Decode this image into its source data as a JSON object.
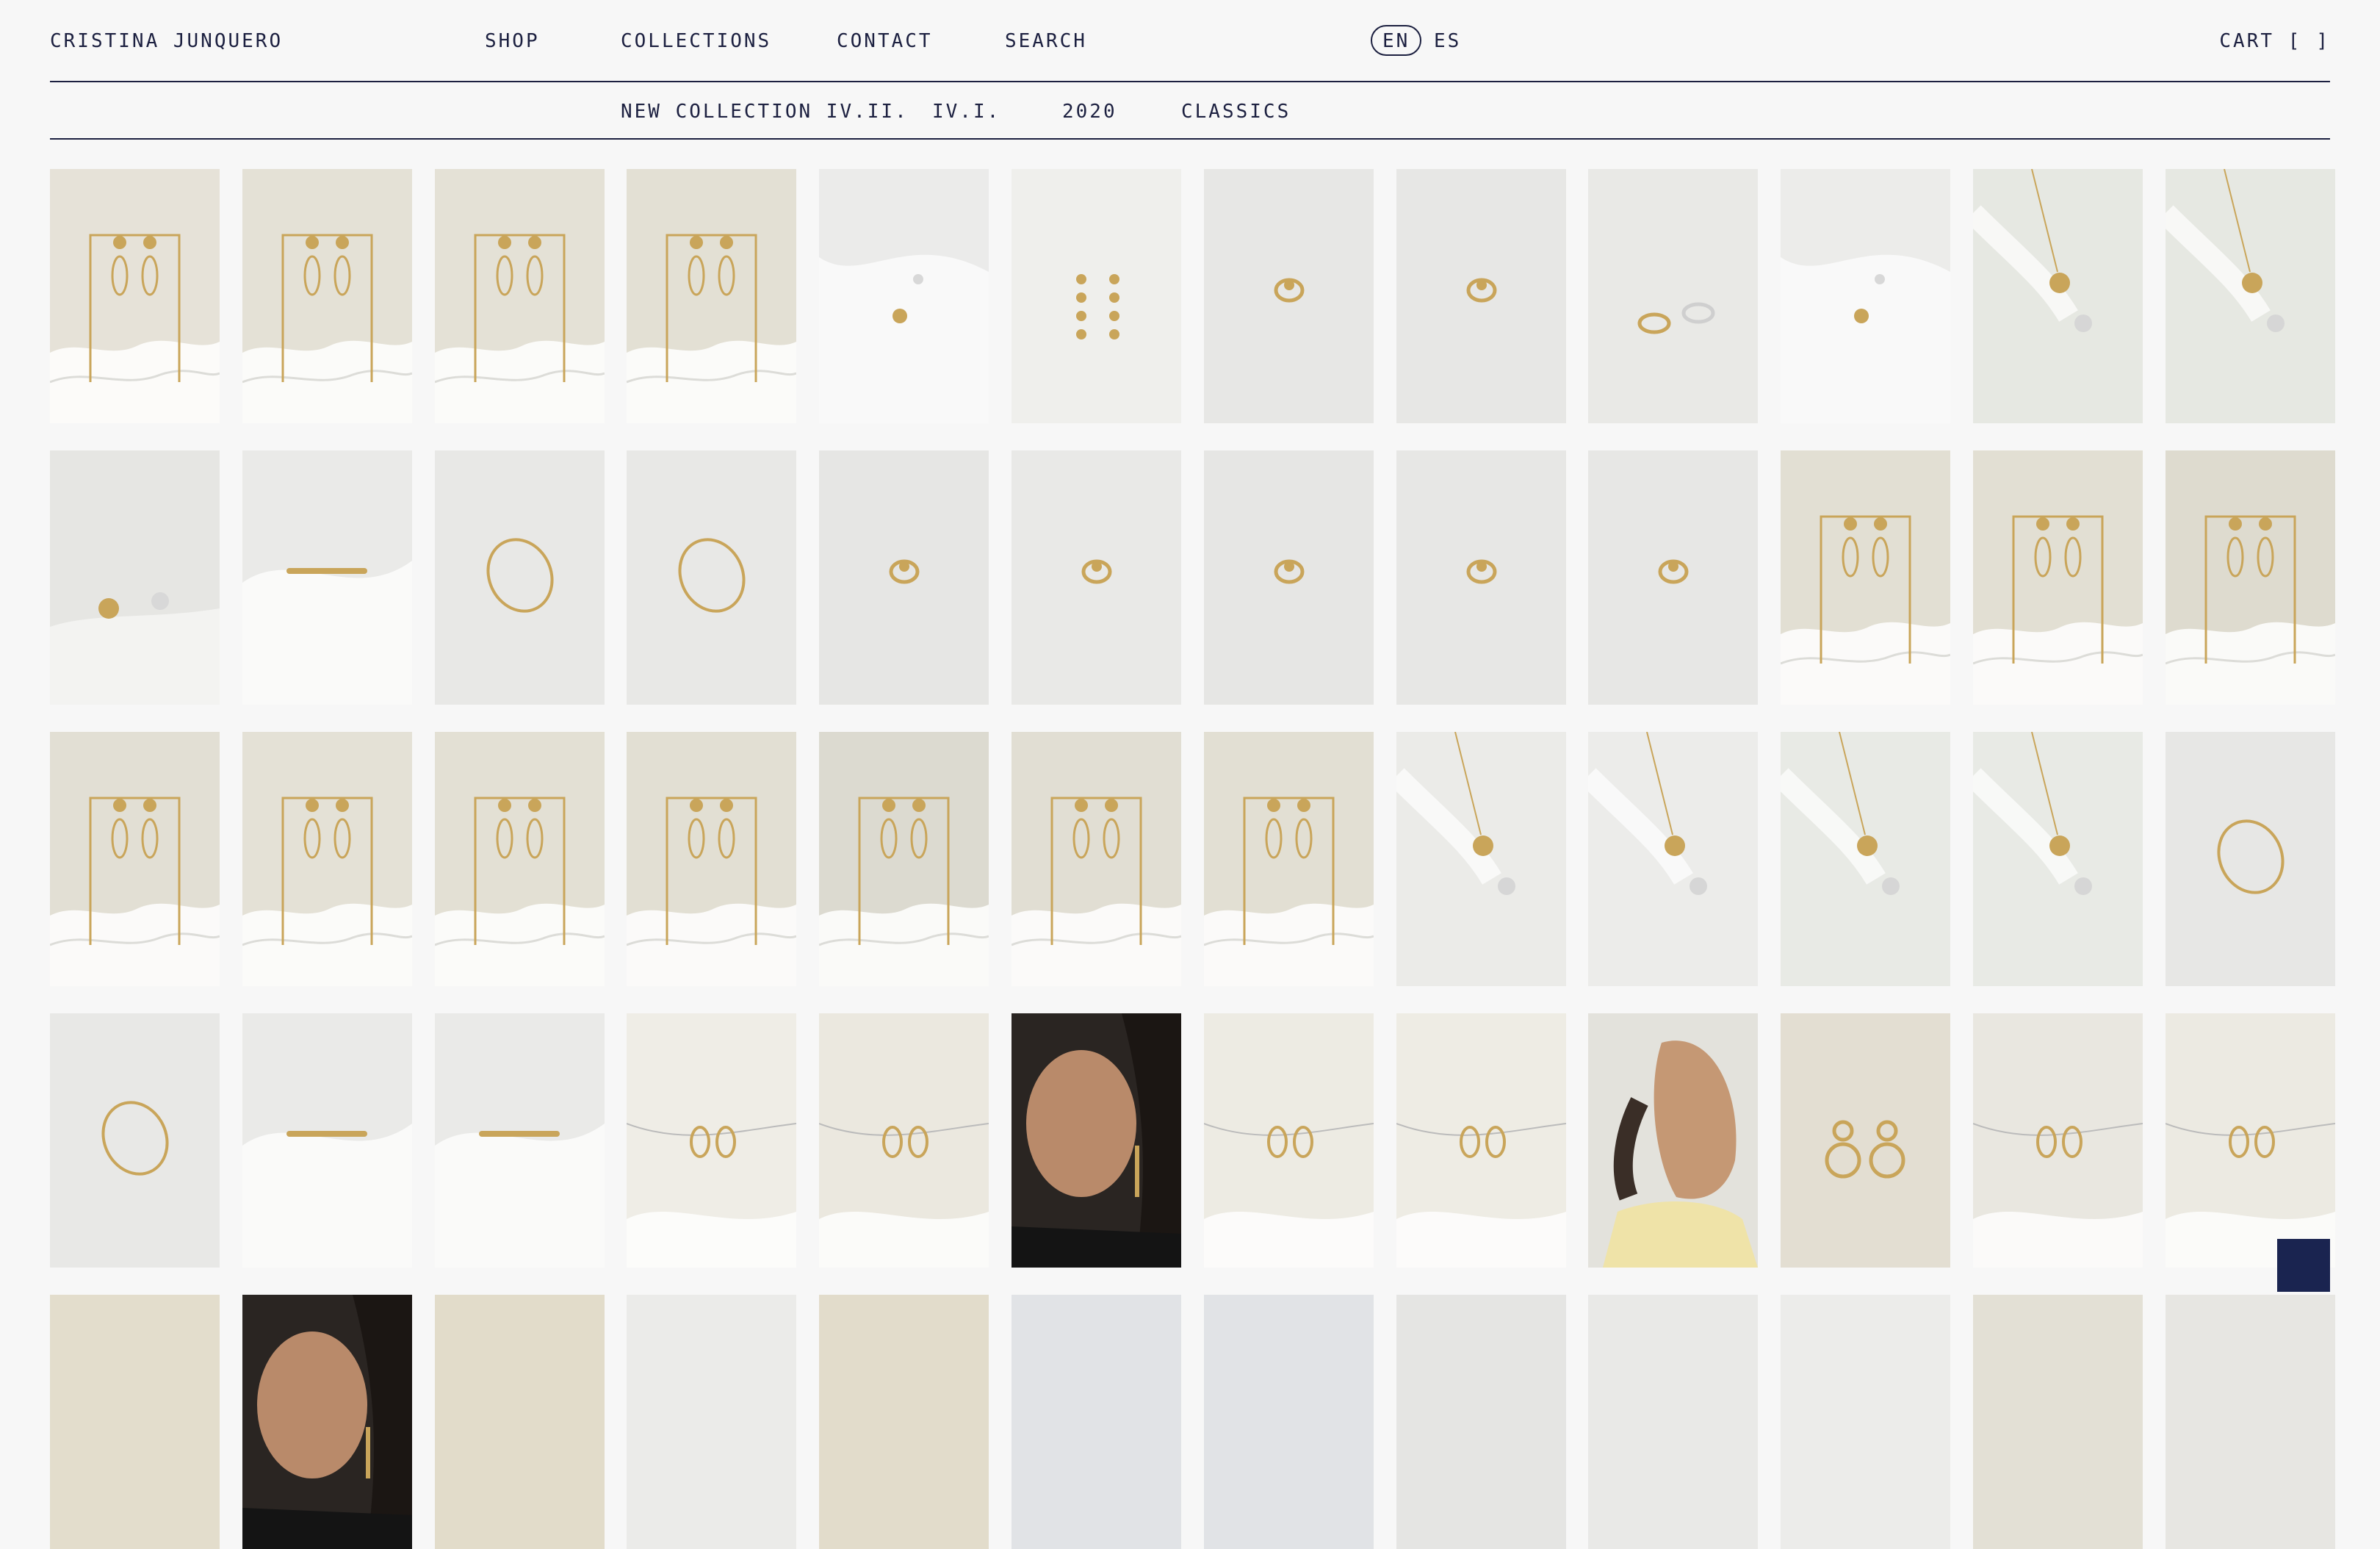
{
  "header": {
    "brand": "CRISTINA JUNQUERO",
    "nav": [
      "SHOP",
      "COLLECTIONS",
      "CONTACT",
      "SEARCH"
    ],
    "languages": [
      "EN",
      "ES"
    ],
    "active_language": "EN",
    "cart_label": "CART",
    "cart_open": "[",
    "cart_close": "]"
  },
  "subnav": [
    "NEW COLLECTION IV.II.",
    "IV.I.",
    "2020",
    "CLASSICS"
  ],
  "colors": {
    "text": "#1c2040",
    "accent": "#1a2450",
    "gold": "#c9a55a",
    "background": "#f7f7f7"
  },
  "products": [
    {
      "bg": "#e6e2d8",
      "type": "earring-stand"
    },
    {
      "bg": "#e4e1d6",
      "type": "earring-stand"
    },
    {
      "bg": "#e4e1d6",
      "type": "earring-stand"
    },
    {
      "bg": "#e3e0d4",
      "type": "earring-stand"
    },
    {
      "bg": "#ebebea",
      "type": "fabric-small"
    },
    {
      "bg": "#efefec",
      "type": "drop-chain"
    },
    {
      "bg": "#e7e7e5",
      "type": "ring"
    },
    {
      "bg": "#e7e7e5",
      "type": "ring"
    },
    {
      "bg": "#e9e9e6",
      "type": "two-rings"
    },
    {
      "bg": "#ececea",
      "type": "fabric-small"
    },
    {
      "bg": "#e6e8e2",
      "type": "necklace"
    },
    {
      "bg": "#e6e8e2",
      "type": "necklace"
    },
    {
      "bg": "#e6e6e3",
      "type": "two-small"
    },
    {
      "bg": "#eaeae8",
      "type": "fabric-bar"
    },
    {
      "bg": "#e8e8e6",
      "type": "bangle"
    },
    {
      "bg": "#e8e8e6",
      "type": "bangle"
    },
    {
      "bg": "#e6e6e4",
      "type": "ring"
    },
    {
      "bg": "#e9e9e7",
      "type": "ring"
    },
    {
      "bg": "#e6e6e4",
      "type": "ring"
    },
    {
      "bg": "#e7e7e5",
      "type": "ring"
    },
    {
      "bg": "#e7e7e5",
      "type": "ring"
    },
    {
      "bg": "#e2dfd3",
      "type": "earring-stand"
    },
    {
      "bg": "#e2dfd3",
      "type": "earring-stand"
    },
    {
      "bg": "#dedbcf",
      "type": "earring-stand"
    },
    {
      "bg": "#e2dfd4",
      "type": "earring-stand"
    },
    {
      "bg": "#e4e1d6",
      "type": "earring-stand"
    },
    {
      "bg": "#e3e0d4",
      "type": "earring-stand"
    },
    {
      "bg": "#e2dfd3",
      "type": "earring-stand"
    },
    {
      "bg": "#dcdad0",
      "type": "earring-stand"
    },
    {
      "bg": "#e1ded3",
      "type": "earring-stand"
    },
    {
      "bg": "#e2dfd3",
      "type": "earring-stand"
    },
    {
      "bg": "#ebebe8",
      "type": "necklace"
    },
    {
      "bg": "#ececea",
      "type": "necklace"
    },
    {
      "bg": "#e8eae5",
      "type": "necklace"
    },
    {
      "bg": "#e8eae5",
      "type": "necklace"
    },
    {
      "bg": "#e7e7e5",
      "type": "bangle"
    },
    {
      "bg": "#e8e8e6",
      "type": "bangle"
    },
    {
      "bg": "#eaeae8",
      "type": "fabric-bar"
    },
    {
      "bg": "#eaeae8",
      "type": "fabric-bar"
    },
    {
      "bg": "#efede6",
      "type": "wire-earrings"
    },
    {
      "bg": "#ebe8df",
      "type": "wire-earrings"
    },
    {
      "bg": "#d8cfc4",
      "type": "portrait-woman"
    },
    {
      "bg": "#edebe3",
      "type": "wire-earrings"
    },
    {
      "bg": "#eeece4",
      "type": "wire-earrings"
    },
    {
      "bg": "#e3e2dc",
      "type": "portrait-man"
    },
    {
      "bg": "#e3ded2",
      "type": "hoops"
    },
    {
      "bg": "#e9e7e0",
      "type": "wire-earrings"
    },
    {
      "bg": "#eceae2",
      "type": "wire-earrings"
    },
    {
      "bg": "#e3ddcc",
      "type": "plain"
    },
    {
      "bg": "#d9cfc4",
      "type": "portrait-woman"
    },
    {
      "bg": "#e2dcca",
      "type": "plain"
    },
    {
      "bg": "#ebebe9",
      "type": "plain"
    },
    {
      "bg": "#e2dccb",
      "type": "plain"
    },
    {
      "bg": "#e1e3e6",
      "type": "plain"
    },
    {
      "bg": "#e1e3e6",
      "type": "plain"
    },
    {
      "bg": "#e5e5e3",
      "type": "plain"
    },
    {
      "bg": "#e9e9e7",
      "type": "plain"
    },
    {
      "bg": "#ececea",
      "type": "plain"
    },
    {
      "bg": "#e3e0d5",
      "type": "plain"
    },
    {
      "bg": "#e7e6e2",
      "type": "plain"
    }
  ]
}
